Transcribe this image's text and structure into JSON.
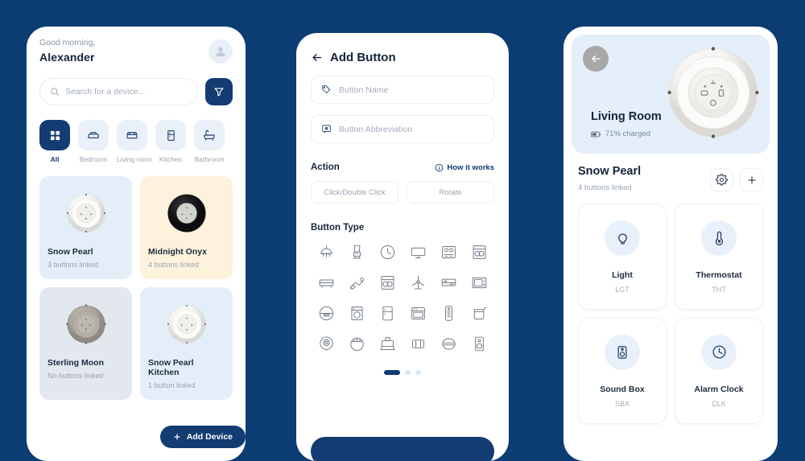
{
  "theme": {
    "background": "#0B3D72",
    "primary": "#123C72",
    "card_blue": "#E3EEF8",
    "card_cream": "#FDF2DC",
    "card_grey": "#E3E8EF",
    "hero_blue": "#E4EFFA"
  },
  "home": {
    "greeting": "Good morning,",
    "user_name": "Alexander",
    "avatar_icon": "user-avatar-icon",
    "search": {
      "placeholder": "Search for a device...",
      "icon": "search-icon"
    },
    "filter_button_icon": "filter-funnel-icon",
    "rooms": [
      {
        "label": "All",
        "icon": "grid-icon",
        "active": true
      },
      {
        "label": "Bedroom",
        "icon": "bed-icon",
        "active": false
      },
      {
        "label": "Living room",
        "icon": "sofa-icon",
        "active": false
      },
      {
        "label": "Kitchen",
        "icon": "fridge-icon",
        "active": false
      },
      {
        "label": "Bathroom",
        "icon": "bathtub-icon",
        "active": false
      }
    ],
    "devices": [
      {
        "name": "Snow Pearl",
        "subtitle": "3 buttons linked",
        "card_color": "#E3EEF8",
        "dial_color": "#FAFAFA"
      },
      {
        "name": "Midnight Onyx",
        "subtitle": "4 buttons linked",
        "card_color": "#FDF2DC",
        "dial_color": "#17181A"
      },
      {
        "name": "Sterling Moon",
        "subtitle": "No buttons linked",
        "card_color": "#E3E8EF",
        "dial_color": "#A9A49C"
      },
      {
        "name": "Snow Pearl Kitchen",
        "subtitle": "1 button linked",
        "card_color": "#E3EEF8",
        "dial_color": "#FAFAFA"
      }
    ],
    "add_device_label": "Add Device",
    "add_device_icon": "plus-icon"
  },
  "add_button": {
    "back_icon": "arrow-left-icon",
    "title": "Add Button",
    "fields": [
      {
        "placeholder": "Button Name",
        "icon": "tag-icon"
      },
      {
        "placeholder": "Button Abbreviation",
        "icon": "abbreviation-icon"
      }
    ],
    "action_section": {
      "title": "Action",
      "help_label": "How it works",
      "help_icon": "info-icon",
      "options": [
        "Click/Double Click",
        "Rotate"
      ]
    },
    "button_type": {
      "title": "Button Type",
      "icons": [
        "pendant-lamp-icon",
        "blender-icon",
        "clock-icon",
        "monitor-icon",
        "stove-icon",
        "dishwasher-icon",
        "heater-icon",
        "vacuum-icon",
        "washer-icon",
        "fan-icon",
        "air-conditioner-icon",
        "microwave-icon",
        "hood-icon",
        "washing-machine-icon",
        "refrigerator-icon",
        "oven-icon",
        "remote-control-icon",
        "kettle-icon",
        "camera-icon",
        "robot-vacuum-icon",
        "toaster-icon",
        "speaker-pair-icon",
        "scale-icon",
        "tower-speaker-icon"
      ]
    },
    "pagination": {
      "pages": 3,
      "current": 1
    }
  },
  "device_detail": {
    "back_icon": "arrow-left-icon",
    "room_name": "Living Room",
    "battery_text": "71% charged",
    "battery_icon": "battery-icon",
    "device_name": "Snow Pearl",
    "device_subtitle": "4 buttons linked",
    "settings_icon": "gear-icon",
    "add_icon": "plus-icon",
    "functions": [
      {
        "label": "Light",
        "abbr": "LGT",
        "icon": "lightbulb-icon"
      },
      {
        "label": "Thermostat",
        "abbr": "THT",
        "icon": "thermometer-icon"
      },
      {
        "label": "Sound Box",
        "abbr": "SBX",
        "icon": "speaker-icon"
      },
      {
        "label": "Alarm Clock",
        "abbr": "CLK",
        "icon": "clock-icon"
      }
    ]
  }
}
